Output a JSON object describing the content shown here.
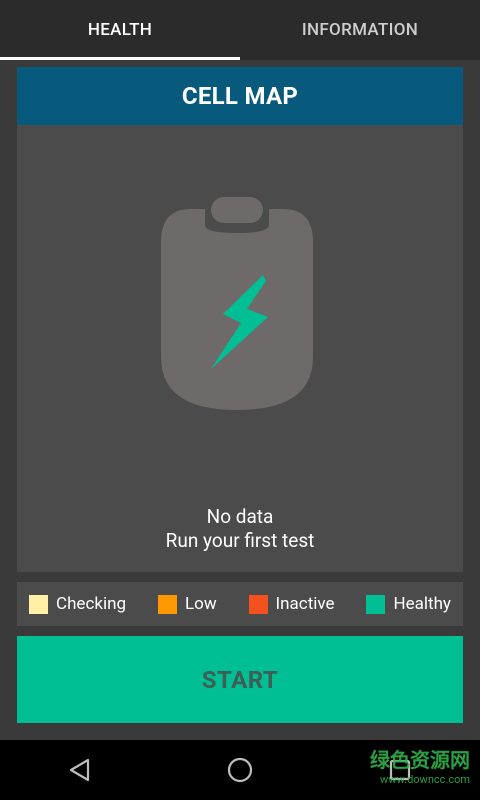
{
  "tabs": [
    {
      "label": "HEALTH",
      "active": true
    },
    {
      "label": "INFORMATION",
      "active": false
    }
  ],
  "panel": {
    "title": "CELL MAP",
    "icon": "battery-charging-icon",
    "no_data_line1": "No data",
    "no_data_line2": "Run your first test"
  },
  "legend": [
    {
      "label": "Checking",
      "color": "#fff0a5"
    },
    {
      "label": "Low",
      "color": "#ff9800"
    },
    {
      "label": "Inactive",
      "color": "#f4511e"
    },
    {
      "label": "Healthy",
      "color": "#00bf94"
    }
  ],
  "start_button": {
    "label": "START"
  },
  "navbar": {
    "back_icon": "back-triangle-icon",
    "home_icon": "home-circle-icon",
    "recents_icon": "recents-square-icon"
  },
  "watermark": {
    "title": "绿色资源网",
    "url": "www.downcc.com"
  },
  "colors": {
    "accent": "#00bf94",
    "header": "#075a7c",
    "panel": "#4b4b4b",
    "background": "#3a3a3a"
  }
}
